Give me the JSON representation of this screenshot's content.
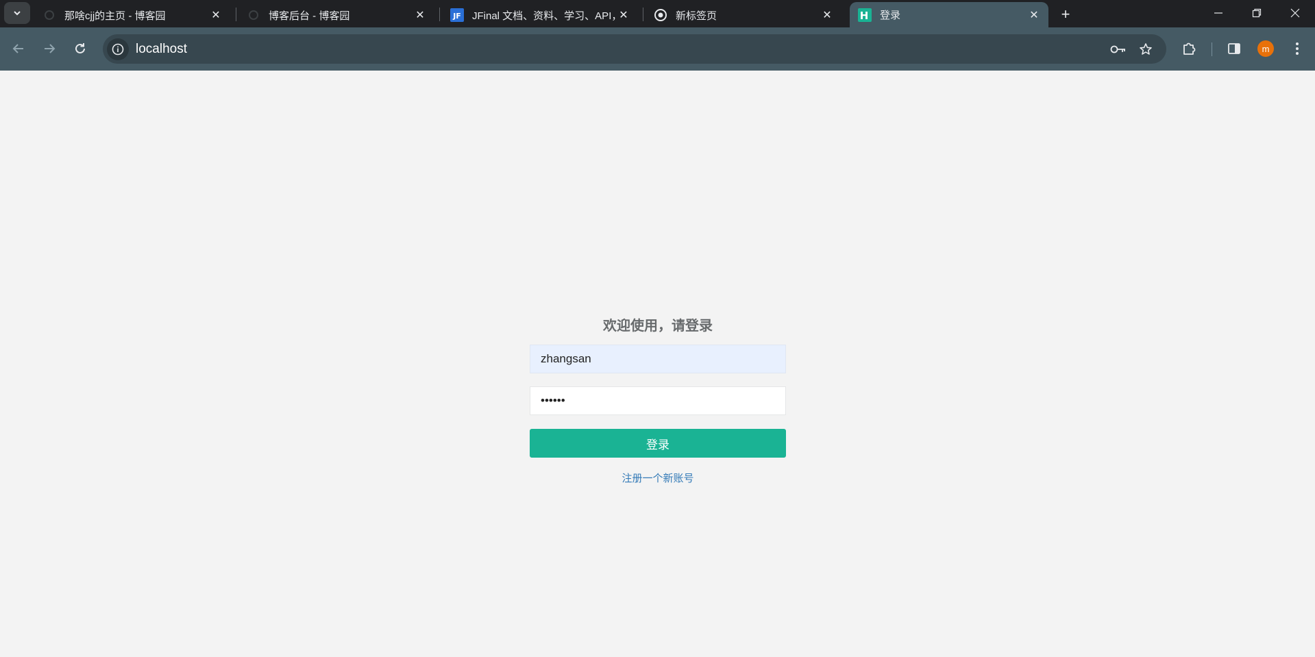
{
  "browser": {
    "tabs": [
      {
        "title": "那啥cjj的主页 - 博客园",
        "close": "✕",
        "active": false
      },
      {
        "title": "博客后台 - 博客园",
        "close": "✕",
        "active": false
      },
      {
        "title": "JFinal 文档、资料、学习、API，",
        "close": "✕",
        "active": false
      },
      {
        "title": "新标签页",
        "close": "✕",
        "active": false
      },
      {
        "title": "登录",
        "close": "✕",
        "active": true
      }
    ],
    "new_tab": "+",
    "address": "localhost",
    "profile_initial": "m",
    "colors": {
      "tabstrip": "#202124",
      "toolbar": "#455a64",
      "omnibox": "#37474f",
      "avatar": "#e8710a"
    }
  },
  "login": {
    "title": "欢迎使用，请登录",
    "username_value": "zhangsan",
    "password_value": "••••••",
    "submit_label": "登录",
    "register_link": "注册一个新账号",
    "colors": {
      "button": "#1ab394",
      "link": "#337ab7",
      "background": "#f3f3f3"
    }
  }
}
